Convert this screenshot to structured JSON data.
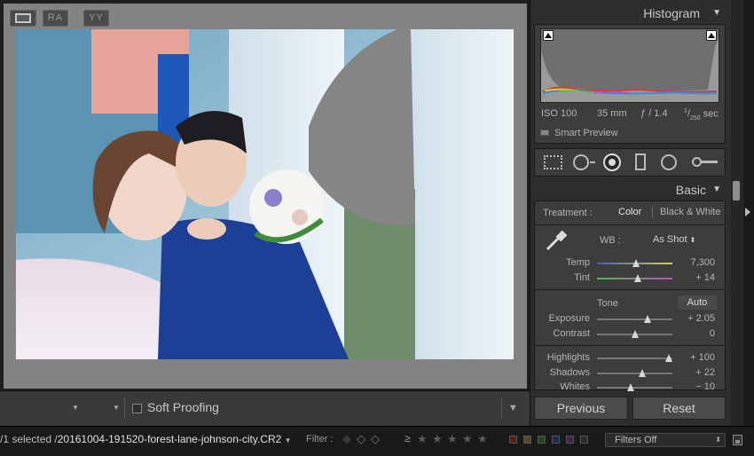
{
  "panel": {
    "histogram": {
      "title": "Histogram",
      "iso": "ISO 100",
      "focal": "35 mm",
      "aperture": "ƒ / 1.4",
      "shutter_num": "1",
      "shutter_den": "250",
      "shutter_unit": " sec",
      "smart_preview": "Smart Preview"
    },
    "basic": {
      "title": "Basic",
      "treatment_label": "Treatment :",
      "treatment_color": "Color",
      "treatment_bw": "Black & White",
      "wb_label": "WB :",
      "wb_value": "As Shot",
      "tone_label": "Tone",
      "auto_label": "Auto",
      "sliders": [
        {
          "label": "Temp",
          "value": "7,300",
          "fraction": 0.52
        },
        {
          "label": "Tint",
          "value": "+ 14",
          "fraction": 0.54
        },
        {
          "label": "Exposure",
          "value": "+ 2.05",
          "fraction": 0.67
        },
        {
          "label": "Contrast",
          "value": "0",
          "fraction": 0.5
        },
        {
          "label": "Highlights",
          "value": "+ 100",
          "fraction": 0.95
        },
        {
          "label": "Shadows",
          "value": "+ 22",
          "fraction": 0.6
        },
        {
          "label": "Whites",
          "value": "− 10",
          "fraction": 0.45
        }
      ]
    },
    "previous_label": "Previous",
    "reset_label": "Reset"
  },
  "toolbar": {
    "soft_proofing": "Soft Proofing"
  },
  "filmstrip": {
    "selected_prefix": "/1 selected /",
    "filename": "20161004-191520-forest-lane-johnson-city.CR2",
    "filter_label": "Filter :",
    "rating_op": "≥",
    "filters_off": "Filters Off"
  },
  "colors": {
    "panel_bg": "#2e2e2e",
    "canvas_bg": "#838383",
    "accent_text": "#d0d0d0"
  }
}
